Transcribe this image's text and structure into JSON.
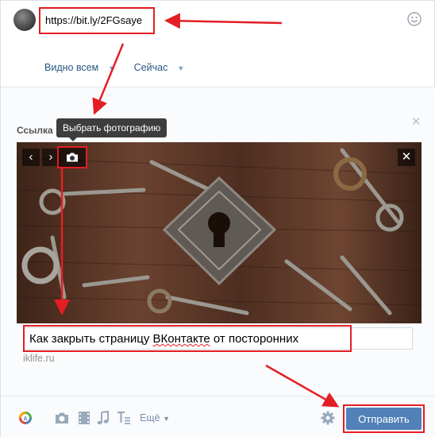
{
  "post": {
    "url_text": "https://bit.ly/2FGsaye",
    "privacy_label": "Видно всем",
    "time_label": "Сейчас"
  },
  "link_preview": {
    "section_label": "Ссылка",
    "tooltip": "Выбрать фотографию",
    "title_before": "Как закрыть страницу ",
    "title_word": "ВКонтакте",
    "title_after": " от посторонних",
    "domain": "iklife.ru"
  },
  "toolbar": {
    "more_label": "Ещё",
    "send_label": "Отправить"
  },
  "icons": {
    "emoji": "smile-icon",
    "attach": [
      "palette-icon",
      "camera-icon",
      "video-icon",
      "music-icon",
      "text-icon"
    ],
    "settings": "gear-icon"
  },
  "colors": {
    "accent": "#5181b8",
    "link": "#2a5885",
    "annotation_red": "#e31e24"
  }
}
